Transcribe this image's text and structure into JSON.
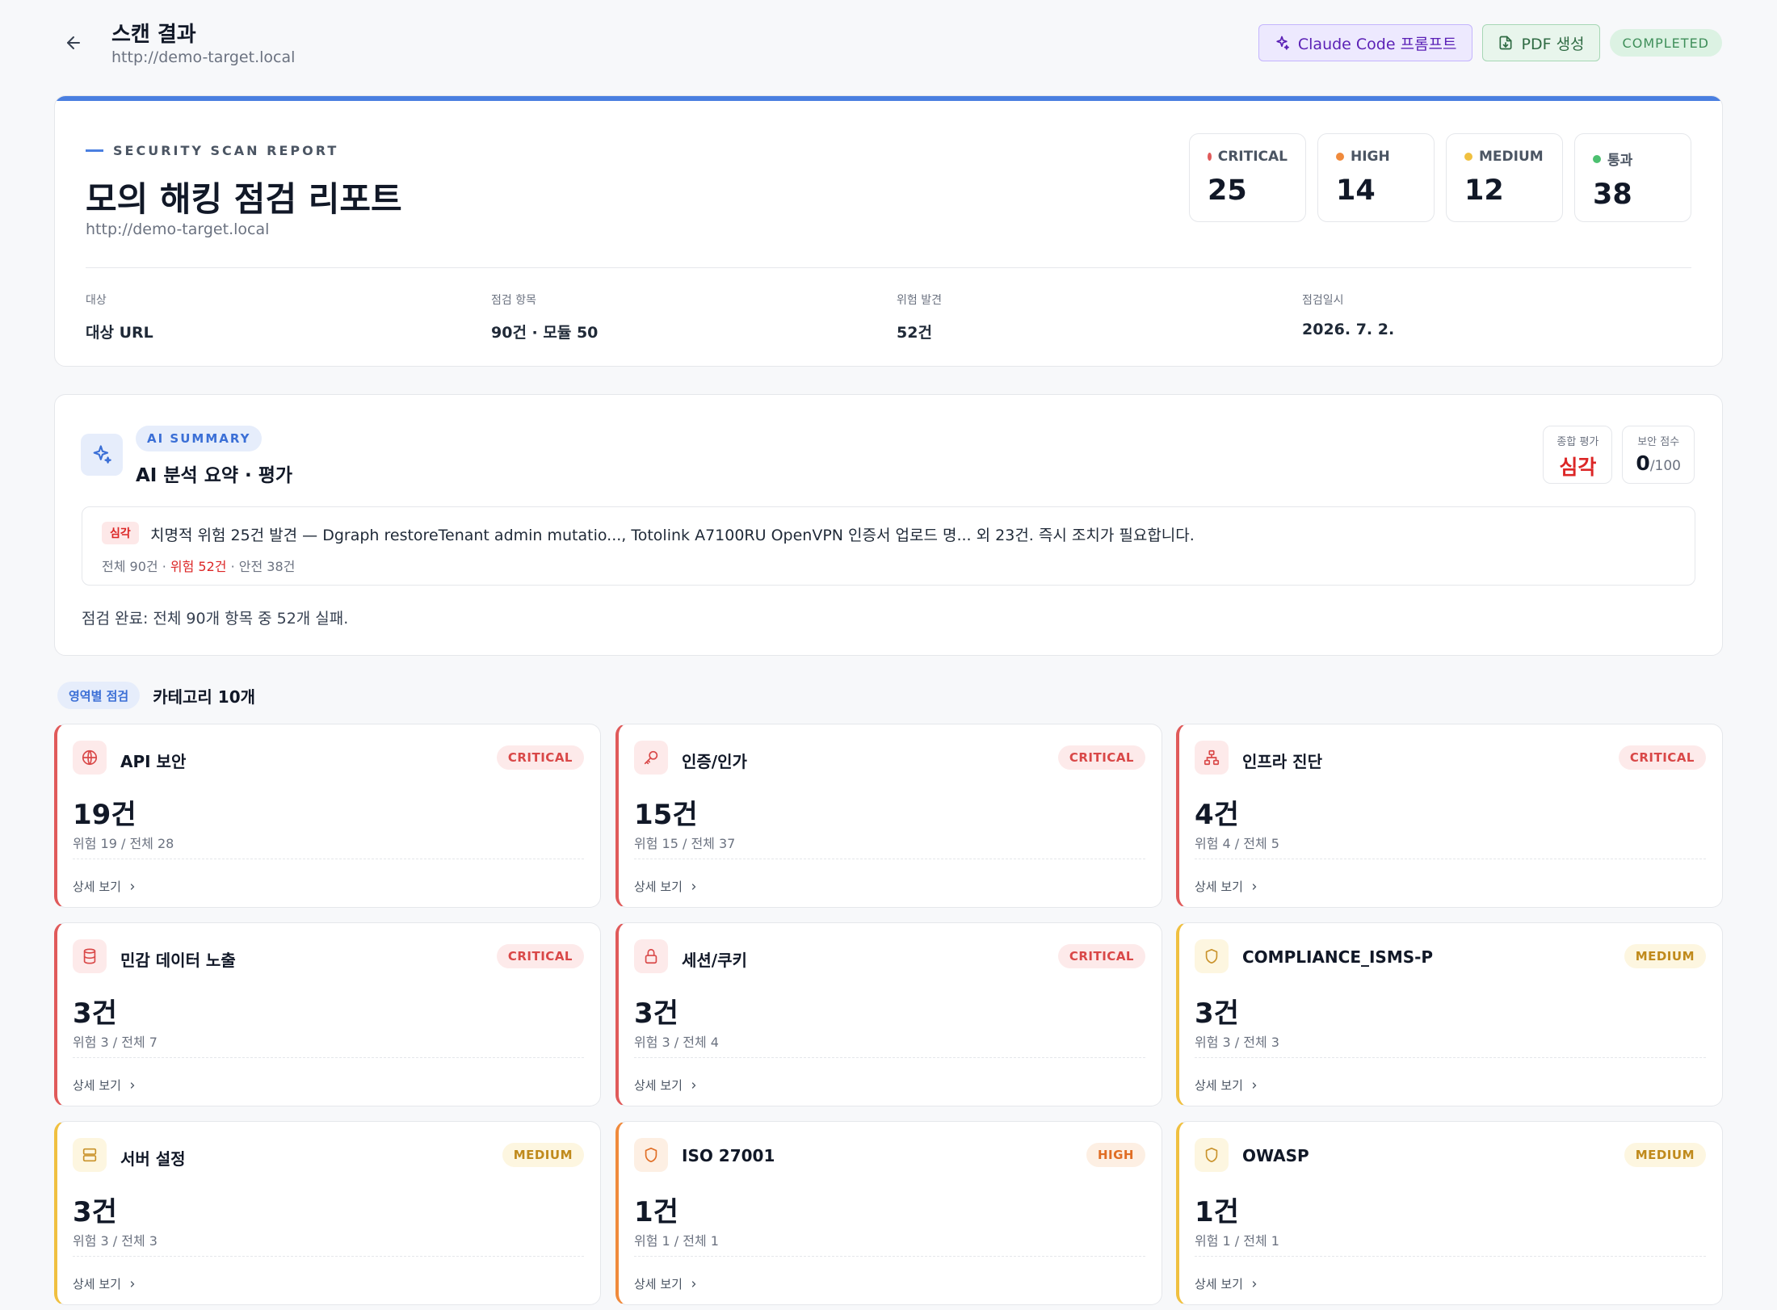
{
  "header": {
    "title": "스캔 결과",
    "url": "http://demo-target.local",
    "claude_btn": "Claude Code 프롬프트",
    "pdf_btn": "PDF 생성",
    "status": "COMPLETED"
  },
  "report": {
    "eyebrow": "SECURITY SCAN REPORT",
    "title": "모의 해킹 점검 리포트",
    "url": "http://demo-target.local",
    "severities": [
      {
        "label": "CRITICAL",
        "count": "25",
        "color": "#e05a5a"
      },
      {
        "label": "HIGH",
        "count": "14",
        "color": "#f08a3c"
      },
      {
        "label": "MEDIUM",
        "count": "12",
        "color": "#f0c040"
      },
      {
        "label": "통과",
        "count": "38",
        "color": "#4cc070"
      }
    ],
    "meta": [
      {
        "label": "대상",
        "value": "대상 URL"
      },
      {
        "label": "점검 항목",
        "value": "90건 · 모듈 50"
      },
      {
        "label": "위험 발견",
        "value": "52건"
      },
      {
        "label": "점검일시",
        "value": "2026. 7. 2."
      }
    ]
  },
  "ai": {
    "badge": "AI SUMMARY",
    "title": "AI 분석 요약 · 평가",
    "overall_label": "종합 평가",
    "overall_value": "심각",
    "score_label": "보안 점수",
    "score_value": "0",
    "score_max": "/100",
    "tag": "심각",
    "message": "치명적 위험 25건 발견 — Dgraph restoreTenant admin mutatio..., Totolink A7100RU OpenVPN 인증서 업로드 명... 외 23건. 즉시 조치가 필요합니다.",
    "stats_total": "전체 90건",
    "stats_sep": " · ",
    "stats_risk": "위험 52건",
    "stats_safe": "안전 38건",
    "footer": "점검 완료: 전체 90개 항목 중 52개 실패."
  },
  "categories_section": {
    "pill": "영역별 점검",
    "count": "카테고리 10개",
    "link_label": "상세 보기"
  },
  "categories": [
    {
      "name": "API 보안",
      "severity": "CRITICAL",
      "count": "19건",
      "sub": "위험 19 / 전체 28",
      "icon": "globe-icon"
    },
    {
      "name": "인증/인가",
      "severity": "CRITICAL",
      "count": "15건",
      "sub": "위험 15 / 전체 37",
      "icon": "key-icon"
    },
    {
      "name": "인프라 진단",
      "severity": "CRITICAL",
      "count": "4건",
      "sub": "위험 4 / 전체 5",
      "icon": "network-icon"
    },
    {
      "name": "민감 데이터 노출",
      "severity": "CRITICAL",
      "count": "3건",
      "sub": "위험 3 / 전체 7",
      "icon": "database-icon"
    },
    {
      "name": "세션/쿠키",
      "severity": "CRITICAL",
      "count": "3건",
      "sub": "위험 3 / 전체 4",
      "icon": "lock-icon"
    },
    {
      "name": "COMPLIANCE_ISMS-P",
      "severity": "MEDIUM",
      "count": "3건",
      "sub": "위험 3 / 전체 3",
      "icon": "shield-icon"
    },
    {
      "name": "서버 설정",
      "severity": "MEDIUM",
      "count": "3건",
      "sub": "위험 3 / 전체 3",
      "icon": "server-icon"
    },
    {
      "name": "ISO 27001",
      "severity": "HIGH",
      "count": "1건",
      "sub": "위험 1 / 전체 1",
      "icon": "shield-icon"
    },
    {
      "name": "OWASP",
      "severity": "MEDIUM",
      "count": "1건",
      "sub": "위험 1 / 전체 1",
      "icon": "shield-icon"
    }
  ]
}
